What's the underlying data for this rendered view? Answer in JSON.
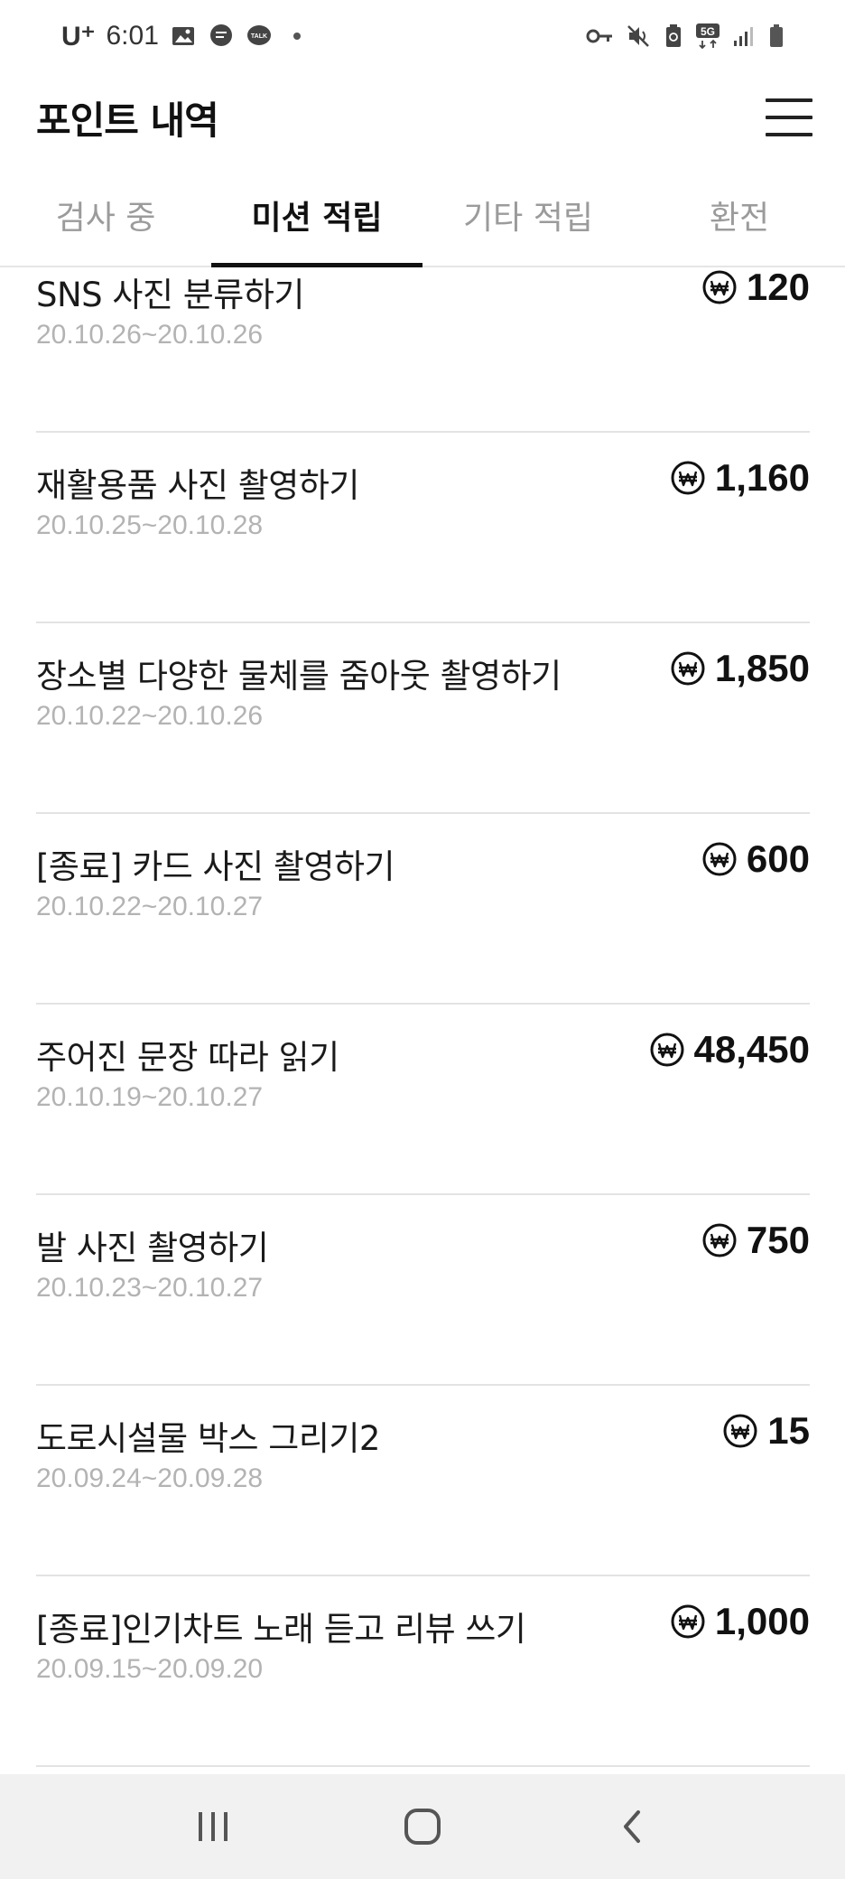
{
  "status_bar": {
    "carrier": "U⁺",
    "time": "6:01",
    "network": "5G"
  },
  "header": {
    "title": "포인트 내역",
    "menu_icon": "hamburger-menu-icon"
  },
  "tabs": [
    {
      "label": "검사 중",
      "active": false
    },
    {
      "label": "미션 적립",
      "active": true
    },
    {
      "label": "기타 적립",
      "active": false
    },
    {
      "label": "환전",
      "active": false
    }
  ],
  "items": [
    {
      "title": "SNS 사진 분류하기",
      "date": "20.10.26~20.10.26",
      "points": "120"
    },
    {
      "title": "재활용품 사진 촬영하기",
      "date": "20.10.25~20.10.28",
      "points": "1,160"
    },
    {
      "title": "장소별 다양한 물체를 줌아웃 촬영하기",
      "date": "20.10.22~20.10.26",
      "points": "1,850"
    },
    {
      "title": "[종료] 카드 사진 촬영하기",
      "date": "20.10.22~20.10.27",
      "points": "600"
    },
    {
      "title": "주어진 문장 따라 읽기",
      "date": "20.10.19~20.10.27",
      "points": "48,450"
    },
    {
      "title": "발 사진 촬영하기",
      "date": "20.10.23~20.10.27",
      "points": "750"
    },
    {
      "title": "도로시설물 박스 그리기2",
      "date": "20.09.24~20.09.28",
      "points": "15"
    },
    {
      "title": "[종료]인기차트 노래 듣고 리뷰 쓰기",
      "date": "20.09.15~20.09.20",
      "points": "1,000"
    }
  ],
  "nav_bar": {
    "icons": [
      "recent-apps-icon",
      "home-icon",
      "back-icon"
    ]
  }
}
